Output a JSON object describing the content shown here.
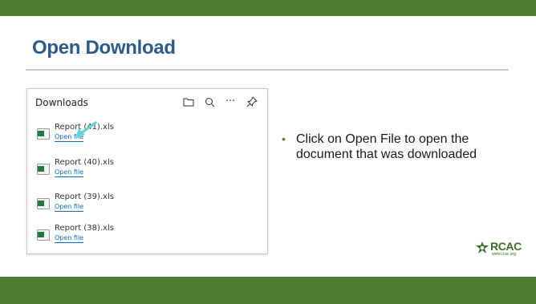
{
  "slide": {
    "title": "Open Download",
    "bullet": "Click on Open File to open the document that was downloaded",
    "colors": {
      "bar": "#4a7d32",
      "title": "#2d5a86",
      "link": "#0f6cbd",
      "arrow": "#5fd6de"
    }
  },
  "downloads_panel": {
    "title": "Downloads",
    "toolbar_icons": [
      "folder-icon",
      "search-icon",
      "more-icon",
      "pin-icon"
    ],
    "more_glyph": "···",
    "items": [
      {
        "name": "Report (41).xls",
        "action": "Open file",
        "icon": "excel-file-icon"
      },
      {
        "name": "Report (40).xls",
        "action": "Open file",
        "icon": "excel-file-icon"
      },
      {
        "name": "Report (39).xls",
        "action": "Open file",
        "icon": "excel-file-icon"
      },
      {
        "name": "Report (38).xls",
        "action": "Open file",
        "icon": "excel-file-icon"
      }
    ]
  },
  "logo": {
    "name": "RCAC",
    "url": "www.rcac.org"
  }
}
